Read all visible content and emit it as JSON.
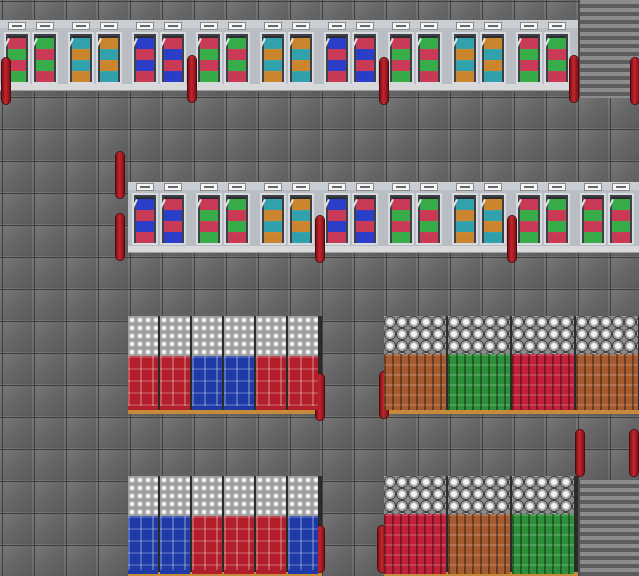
{
  "colors": {
    "floor": "#5a5a5a",
    "fridge_frame": "#b8bec4",
    "post": "#c4252e",
    "stairs": "#8c8c8c"
  },
  "fridge_palettes": [
    [
      "#d23b58",
      "#39b34a"
    ],
    [
      "#33a8b3",
      "#d58a2f"
    ],
    [
      "#2b3fd0",
      "#d23b58"
    ],
    [
      "#d23b58",
      "#39b34a"
    ],
    [
      "#33a8b3",
      "#d58a2f"
    ],
    [
      "#2b3fd0",
      "#d23b58"
    ],
    [
      "#d23b58",
      "#39b34a"
    ],
    [
      "#33a8b3",
      "#d58a2f"
    ],
    [
      "#d23b58",
      "#39b34a"
    ]
  ],
  "crate_colors_upper": [
    "#b21f2a",
    "#b21f2a",
    "#1e3aa6",
    "#1e3aa6",
    "#b21f2a",
    "#b21f2a"
  ],
  "crate_colors_lower": [
    "#1e3aa6",
    "#1e3aa6",
    "#b21f2a",
    "#b21f2a",
    "#b21f2a",
    "#1e3aa6"
  ],
  "bottle_colors_upper": [
    "#a45b2f",
    "#2e8f3a",
    "#c0203a",
    "#a45b2f"
  ],
  "bottle_colors_lower": [
    "#c0203a",
    "#a45b2f",
    "#2e8f3a"
  ]
}
